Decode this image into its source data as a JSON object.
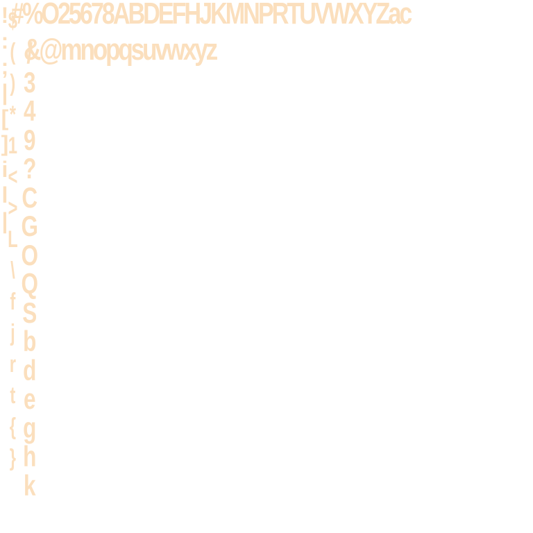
{
  "top_marks": "\"–˜ –` ~",
  "row_1": "#%O25678ABDEFHJKMNPRTUVWXYZac",
  "row_2": "&@mnopqsuvwxyz",
  "column_1": [
    "!",
    ":",
    ";",
    "|",
    "[",
    "]",
    "i",
    "l",
    "|"
  ],
  "column_2": [
    "$",
    "(",
    ")",
    "*",
    "1",
    "<",
    ">",
    "L",
    "\\",
    "f",
    "j",
    "r",
    "t",
    "{",
    "}"
  ],
  "column_3": [
    "/",
    "3",
    "4",
    "9",
    "?",
    "C",
    "G",
    "O",
    "Q",
    "S",
    "b",
    "d",
    "e",
    "g",
    "h",
    "k"
  ]
}
